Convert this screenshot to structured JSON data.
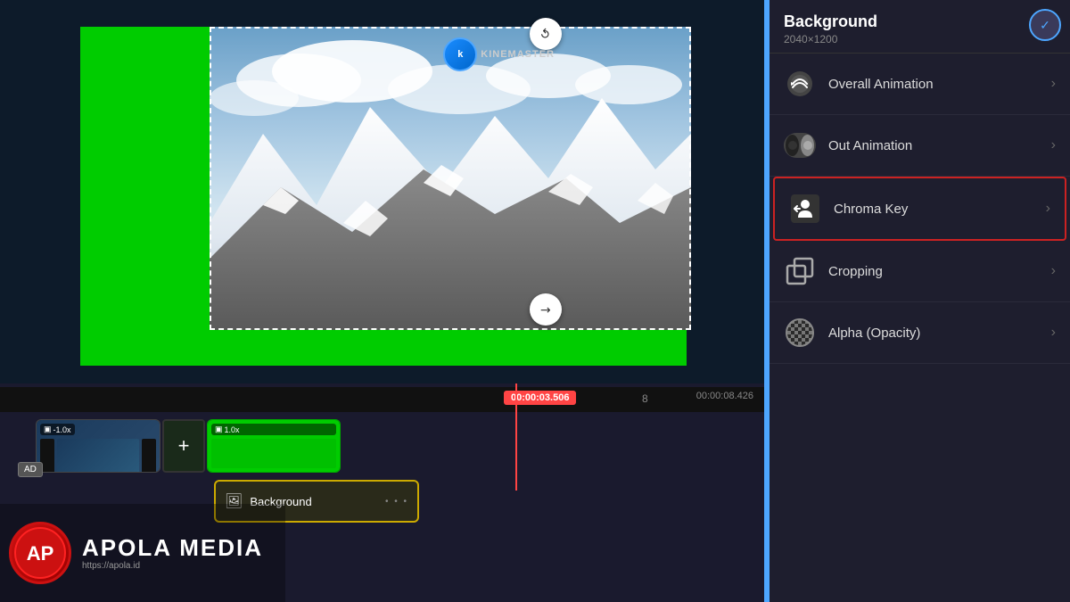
{
  "preview": {
    "width": "1200",
    "height": "675"
  },
  "panel": {
    "title": "Background",
    "dimensions": "2040×1200",
    "close_button_label": "✓",
    "items": [
      {
        "id": "overall-animation",
        "label": "Overall Animation",
        "icon": "overall-animation-icon",
        "arrow": "›"
      },
      {
        "id": "out-animation",
        "label": "Out Animation",
        "icon": "out-animation-icon",
        "arrow": "›"
      },
      {
        "id": "chroma-key",
        "label": "Chroma Key",
        "icon": "chroma-key-icon",
        "arrow": "›",
        "highlighted": true
      },
      {
        "id": "cropping",
        "label": "Cropping",
        "icon": "cropping-icon",
        "arrow": "›"
      },
      {
        "id": "alpha-opacity",
        "label": "Alpha (Opacity)",
        "icon": "alpha-opacity-icon",
        "arrow": "›"
      }
    ]
  },
  "timeline": {
    "current_time": "00:00:03.506",
    "end_time": "00:00:08.426",
    "ruler_marker": "8",
    "tracks": [
      {
        "id": "main-video",
        "clips": [
          {
            "type": "video",
            "speed": "-1.0x"
          },
          {
            "type": "add"
          },
          {
            "type": "green",
            "speed": "1.0x"
          }
        ]
      },
      {
        "id": "background-track",
        "clips": [
          {
            "type": "background",
            "label": "Background"
          }
        ]
      }
    ]
  },
  "watermark": {
    "logo_letter": "A",
    "title": "APOLA MEDIA",
    "subtitle": "https://apola.id"
  },
  "ad_badge": "AD",
  "kinemaster": {
    "text": "KINEMASTER"
  }
}
